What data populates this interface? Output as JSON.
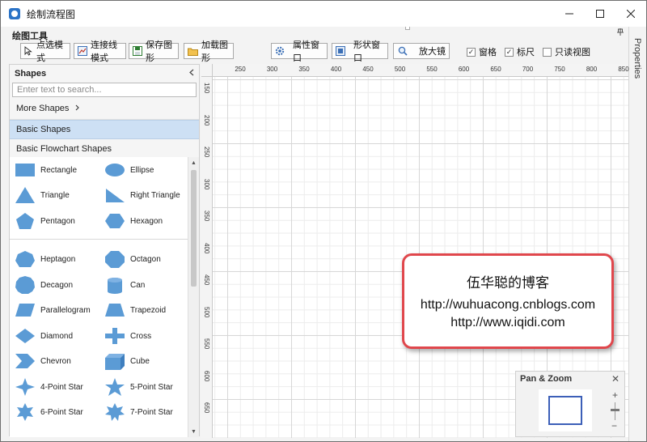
{
  "window": {
    "title": "绘制流程图",
    "icon": "app-icon",
    "buttons": [
      "minimize",
      "maximize",
      "close"
    ]
  },
  "ribbon": {
    "caption": "绘图工具",
    "pin": "ㅂ",
    "buttons": [
      {
        "label": "点选模式",
        "icon": "pointer-icon"
      },
      {
        "label": "连接线模式",
        "icon": "connector-icon"
      },
      {
        "label": "保存图形",
        "icon": "save-icon"
      },
      {
        "label": "加载图形",
        "icon": "open-folder-icon"
      },
      {
        "label": "属性窗口",
        "icon": "gear-icon"
      },
      {
        "label": "形状窗口",
        "icon": "shapes-window-icon"
      },
      {
        "label": "放大镜",
        "icon": "magnifier-icon"
      }
    ],
    "checkboxes": [
      {
        "label": "窗格",
        "checked": true
      },
      {
        "label": "标尺",
        "checked": true
      },
      {
        "label": "只读视图",
        "checked": false
      }
    ]
  },
  "properties_tab": {
    "label": "Properties"
  },
  "shapes_panel": {
    "title": "Shapes",
    "search_placeholder": "Enter text to search...",
    "more_shapes": "More Shapes",
    "categories": [
      "Basic Shapes",
      "Basic Flowchart Shapes"
    ],
    "active_category": "Basic Shapes",
    "shape_color": "#5b9bd5",
    "group1": [
      [
        "Rectangle",
        "Ellipse"
      ],
      [
        "Triangle",
        "Right Triangle"
      ],
      [
        "Pentagon",
        "Hexagon"
      ]
    ],
    "group2": [
      [
        "Heptagon",
        "Octagon"
      ],
      [
        "Decagon",
        "Can"
      ],
      [
        "Parallelogram",
        "Trapezoid"
      ],
      [
        "Diamond",
        "Cross"
      ],
      [
        "Chevron",
        "Cube"
      ],
      [
        "4-Point Star",
        "5-Point Star"
      ],
      [
        "6-Point Star",
        "7-Point Star"
      ]
    ]
  },
  "ruler": {
    "top": [
      "250",
      "300",
      "350",
      "400",
      "450",
      "500",
      "550",
      "600",
      "650",
      "700",
      "750",
      "800",
      "850"
    ],
    "left": [
      "150",
      "200",
      "250",
      "300",
      "350",
      "400",
      "450",
      "500",
      "550",
      "600",
      "650"
    ]
  },
  "note": {
    "line1": "伍华聪的博客",
    "line2": "http://wuhuacong.cnblogs.com",
    "line3": "http://www.iqidi.com",
    "border_color": "#e0474c"
  },
  "pan_zoom": {
    "title": "Pan & Zoom",
    "plus": "+",
    "minus": "−",
    "close": "✕"
  }
}
